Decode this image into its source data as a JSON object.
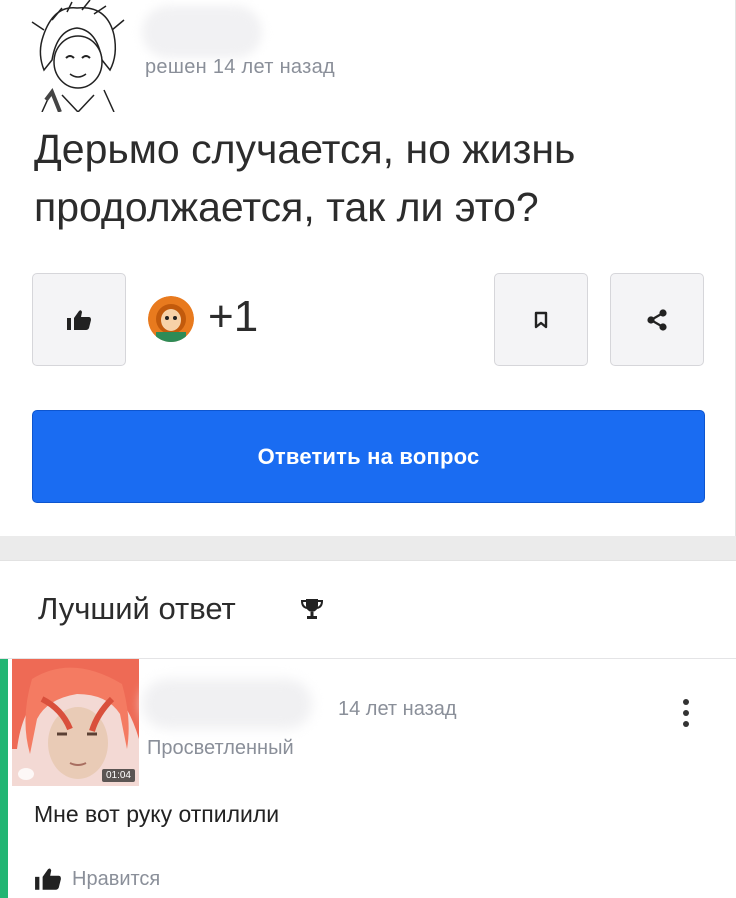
{
  "question": {
    "meta": "решен 14 лет назад",
    "title": "Дерьмо случается, но жизнь продолжается, так ли это?",
    "like_count": "+1",
    "answer_button_label": "Ответить на вопрос"
  },
  "best_answer": {
    "section_title": "Лучший ответ",
    "time": "14 лет назад",
    "rank": "Просветленный",
    "avatar_badge": "01:04",
    "text": "Мне вот руку отпилили",
    "like_label": "Нравится"
  },
  "colors": {
    "primary": "#1a6cf2",
    "accent_bar": "#22b573",
    "muted_text": "#8a8f99"
  }
}
